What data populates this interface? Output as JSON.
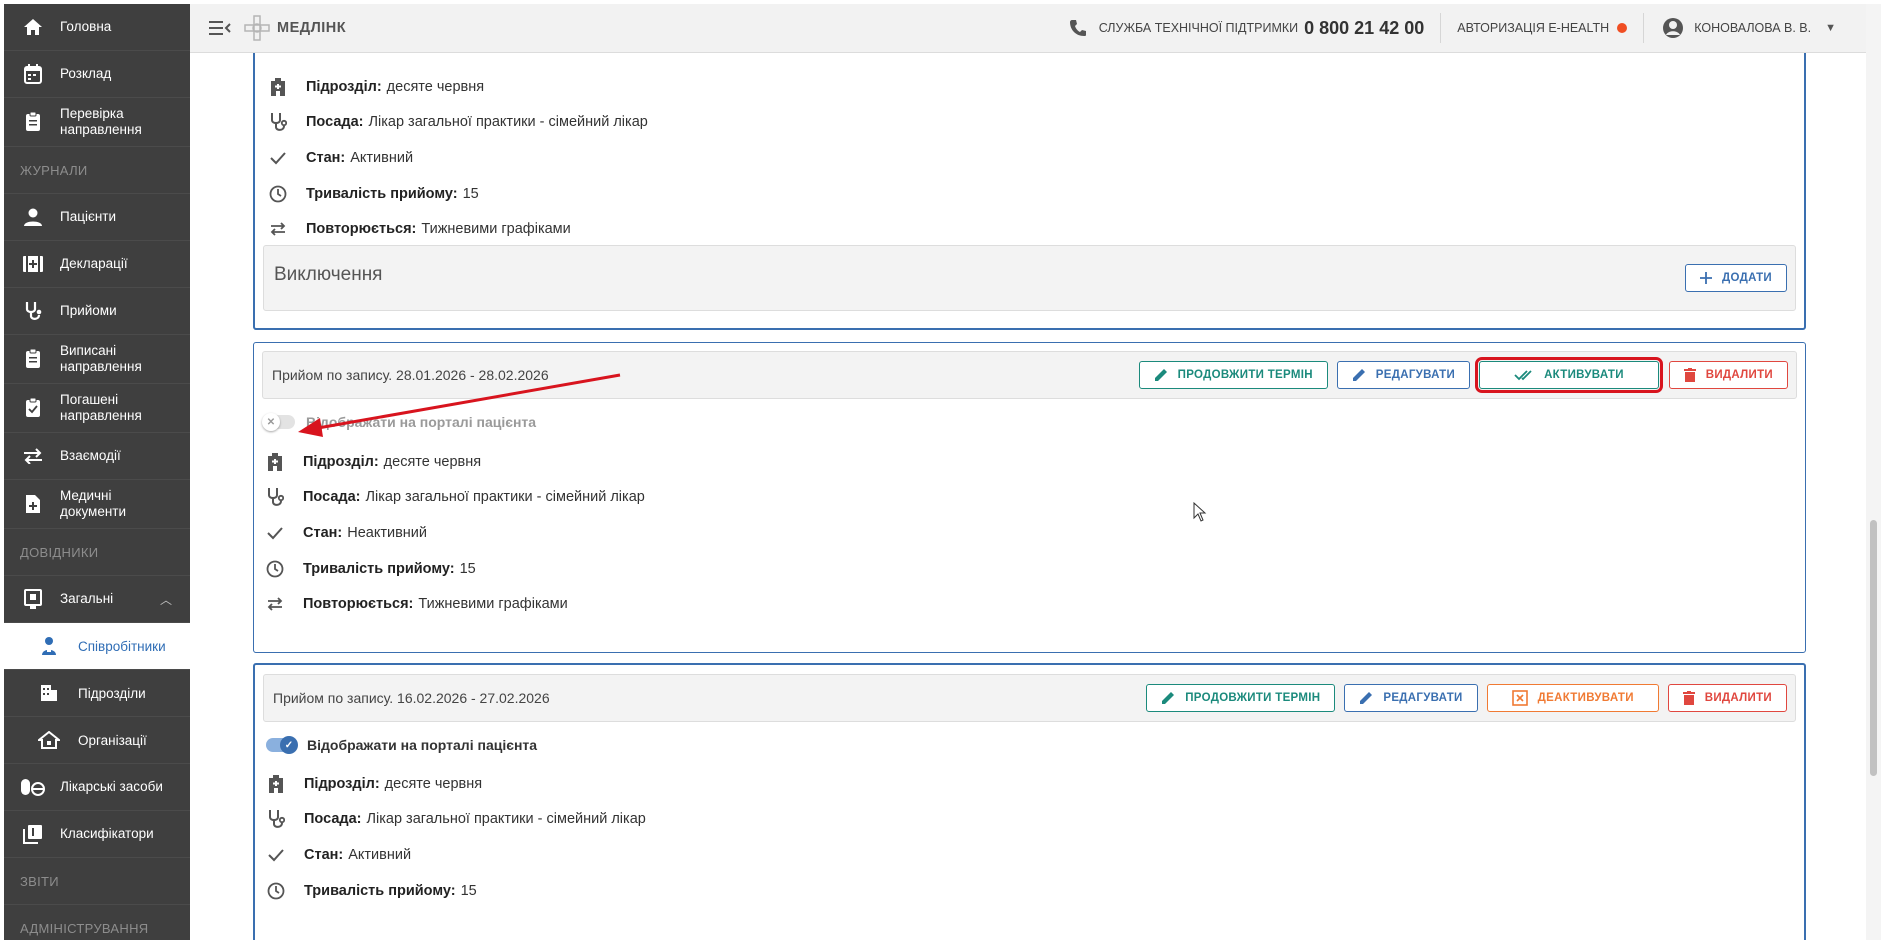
{
  "app": {
    "brand": "МЕДЛІНК"
  },
  "sidebar": {
    "top_items": [
      {
        "label": "Головна",
        "icon": "home-icon"
      },
      {
        "label": "Розклад",
        "icon": "calendar-icon"
      },
      {
        "label": "Перевірка направлення",
        "icon": "clipboard-icon"
      }
    ],
    "section_journals": "ЖУРНАЛИ",
    "journal_items": [
      {
        "label": "Пацієнти",
        "icon": "person-icon"
      },
      {
        "label": "Декларації",
        "icon": "declaration-icon"
      },
      {
        "label": "Прийоми",
        "icon": "stethoscope-icon"
      },
      {
        "label": "Виписані направлення",
        "icon": "clipboard-icon"
      },
      {
        "label": "Погашені направлення",
        "icon": "clipboard-check-icon"
      },
      {
        "label": "Взаємодії",
        "icon": "swap-icon"
      },
      {
        "label": "Медичні документи",
        "icon": "document-plus-icon"
      }
    ],
    "section_refs": "ДОВІДНИКИ",
    "general": {
      "label": "Загальні",
      "icon": "badge-icon"
    },
    "general_sub": [
      {
        "label": "Співробітники",
        "icon": "employee-icon",
        "active": true
      },
      {
        "label": "Підрозділи",
        "icon": "building-icon"
      },
      {
        "label": "Організації",
        "icon": "organization-icon"
      }
    ],
    "other_items": [
      {
        "label": "Лікарські засоби",
        "icon": "pills-icon"
      },
      {
        "label": "Класифікатори",
        "icon": "library-icon"
      }
    ],
    "section_reports": "ЗВІТИ",
    "section_admin": "АДМІНІСТРУВАННЯ"
  },
  "header": {
    "support_label": "СЛУЖБА ТЕХНІЧНОЇ ПІДТРИМКИ",
    "support_phone": "0 800 21 42 00",
    "ehealth_label": "АВТОРИЗАЦІЯ E-HEALTH",
    "ehealth_status_color": "#f04e23",
    "user_name": "КОНОВАЛОВА В. В."
  },
  "labels": {
    "department": "Підрозділ:",
    "position": "Посада:",
    "state": "Стан:",
    "duration": "Тривалість прийому:",
    "repeats": "Повторюється:",
    "portal_toggle": "Відображати на порталі пацієнта",
    "exclusions": "Виключення",
    "add": "ДОДАТИ"
  },
  "buttons": {
    "extend": "ПРОДОВЖИТИ ТЕРМІН",
    "edit": "РЕДАГУВАТИ",
    "activate": "АКТИВУВАТИ",
    "deactivate": "ДЕАКТИВУВАТИ",
    "delete": "ВИДАЛИТИ"
  },
  "cards": [
    {
      "department": "десяте червня",
      "position": "Лікар загальної практики - сімейний лікар",
      "state": "Активний",
      "duration": "15",
      "repeats": "Тижневими графіками"
    },
    {
      "title": "Прийом по запису. 28.01.2026 - 28.02.2026",
      "portal_visible": false,
      "department": "десяте червня",
      "position": "Лікар загальної практики - сімейний лікар",
      "state": "Неактивний",
      "duration": "15",
      "repeats": "Тижневими графіками"
    },
    {
      "title": "Прийом по запису. 16.02.2026 - 27.02.2026",
      "portal_visible": true,
      "department": "десяте червня",
      "position": "Лікар загальної практики - сімейний лікар",
      "state": "Активний",
      "duration": "15"
    }
  ],
  "colors": {
    "accent": "#3a6fb0",
    "teal": "#1b8a7c",
    "orange": "#f07a33",
    "red": "#e0473f",
    "highlight": "#d8141e"
  }
}
